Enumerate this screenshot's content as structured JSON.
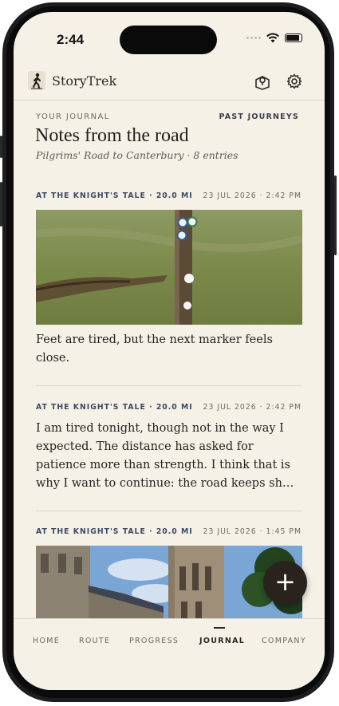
{
  "status_bar": {
    "time": "2:44"
  },
  "header": {
    "brand": "StoryTrek"
  },
  "journal": {
    "eyebrow": "YOUR JOURNAL",
    "past_link": "PAST JOURNEYS",
    "title": "Notes from the road",
    "subtitle": "Pilgrims' Road to Canterbury · 8 entries"
  },
  "entries": [
    {
      "place": "AT THE KNIGHT'S TALE · 20.0 MI",
      "when": "23 JUL 2026 · 2:42 PM",
      "text": "Feet are tired, but the next marker feels close."
    },
    {
      "place": "AT THE KNIGHT'S TALE · 20.0 MI",
      "when": "23 JUL 2026 · 2:42 PM",
      "text": "I am tired tonight, though not in the way I expected. The distance has asked for patience more than strength. I think that is why I want to continue: the road keeps sh…"
    },
    {
      "place": "AT THE KNIGHT'S TALE · 20.0 MI",
      "when": "23 JUL 2026 · 1:45 PM",
      "text": ""
    }
  ],
  "fab": {
    "label": "+"
  },
  "tabs": [
    {
      "label": "HOME"
    },
    {
      "label": "ROUTE"
    },
    {
      "label": "PROGRESS"
    },
    {
      "label": "JOURNAL"
    },
    {
      "label": "COMPANY"
    }
  ],
  "icons": {
    "logo": "walking-pilgrim-icon",
    "map": "map-pin-icon",
    "settings": "gear-icon",
    "signal": "signal-icon",
    "wifi": "wifi-icon",
    "battery": "battery-icon"
  },
  "colors": {
    "background": "#f6f1e7",
    "accent": "#3b4a63",
    "fab": "#2a221c"
  }
}
